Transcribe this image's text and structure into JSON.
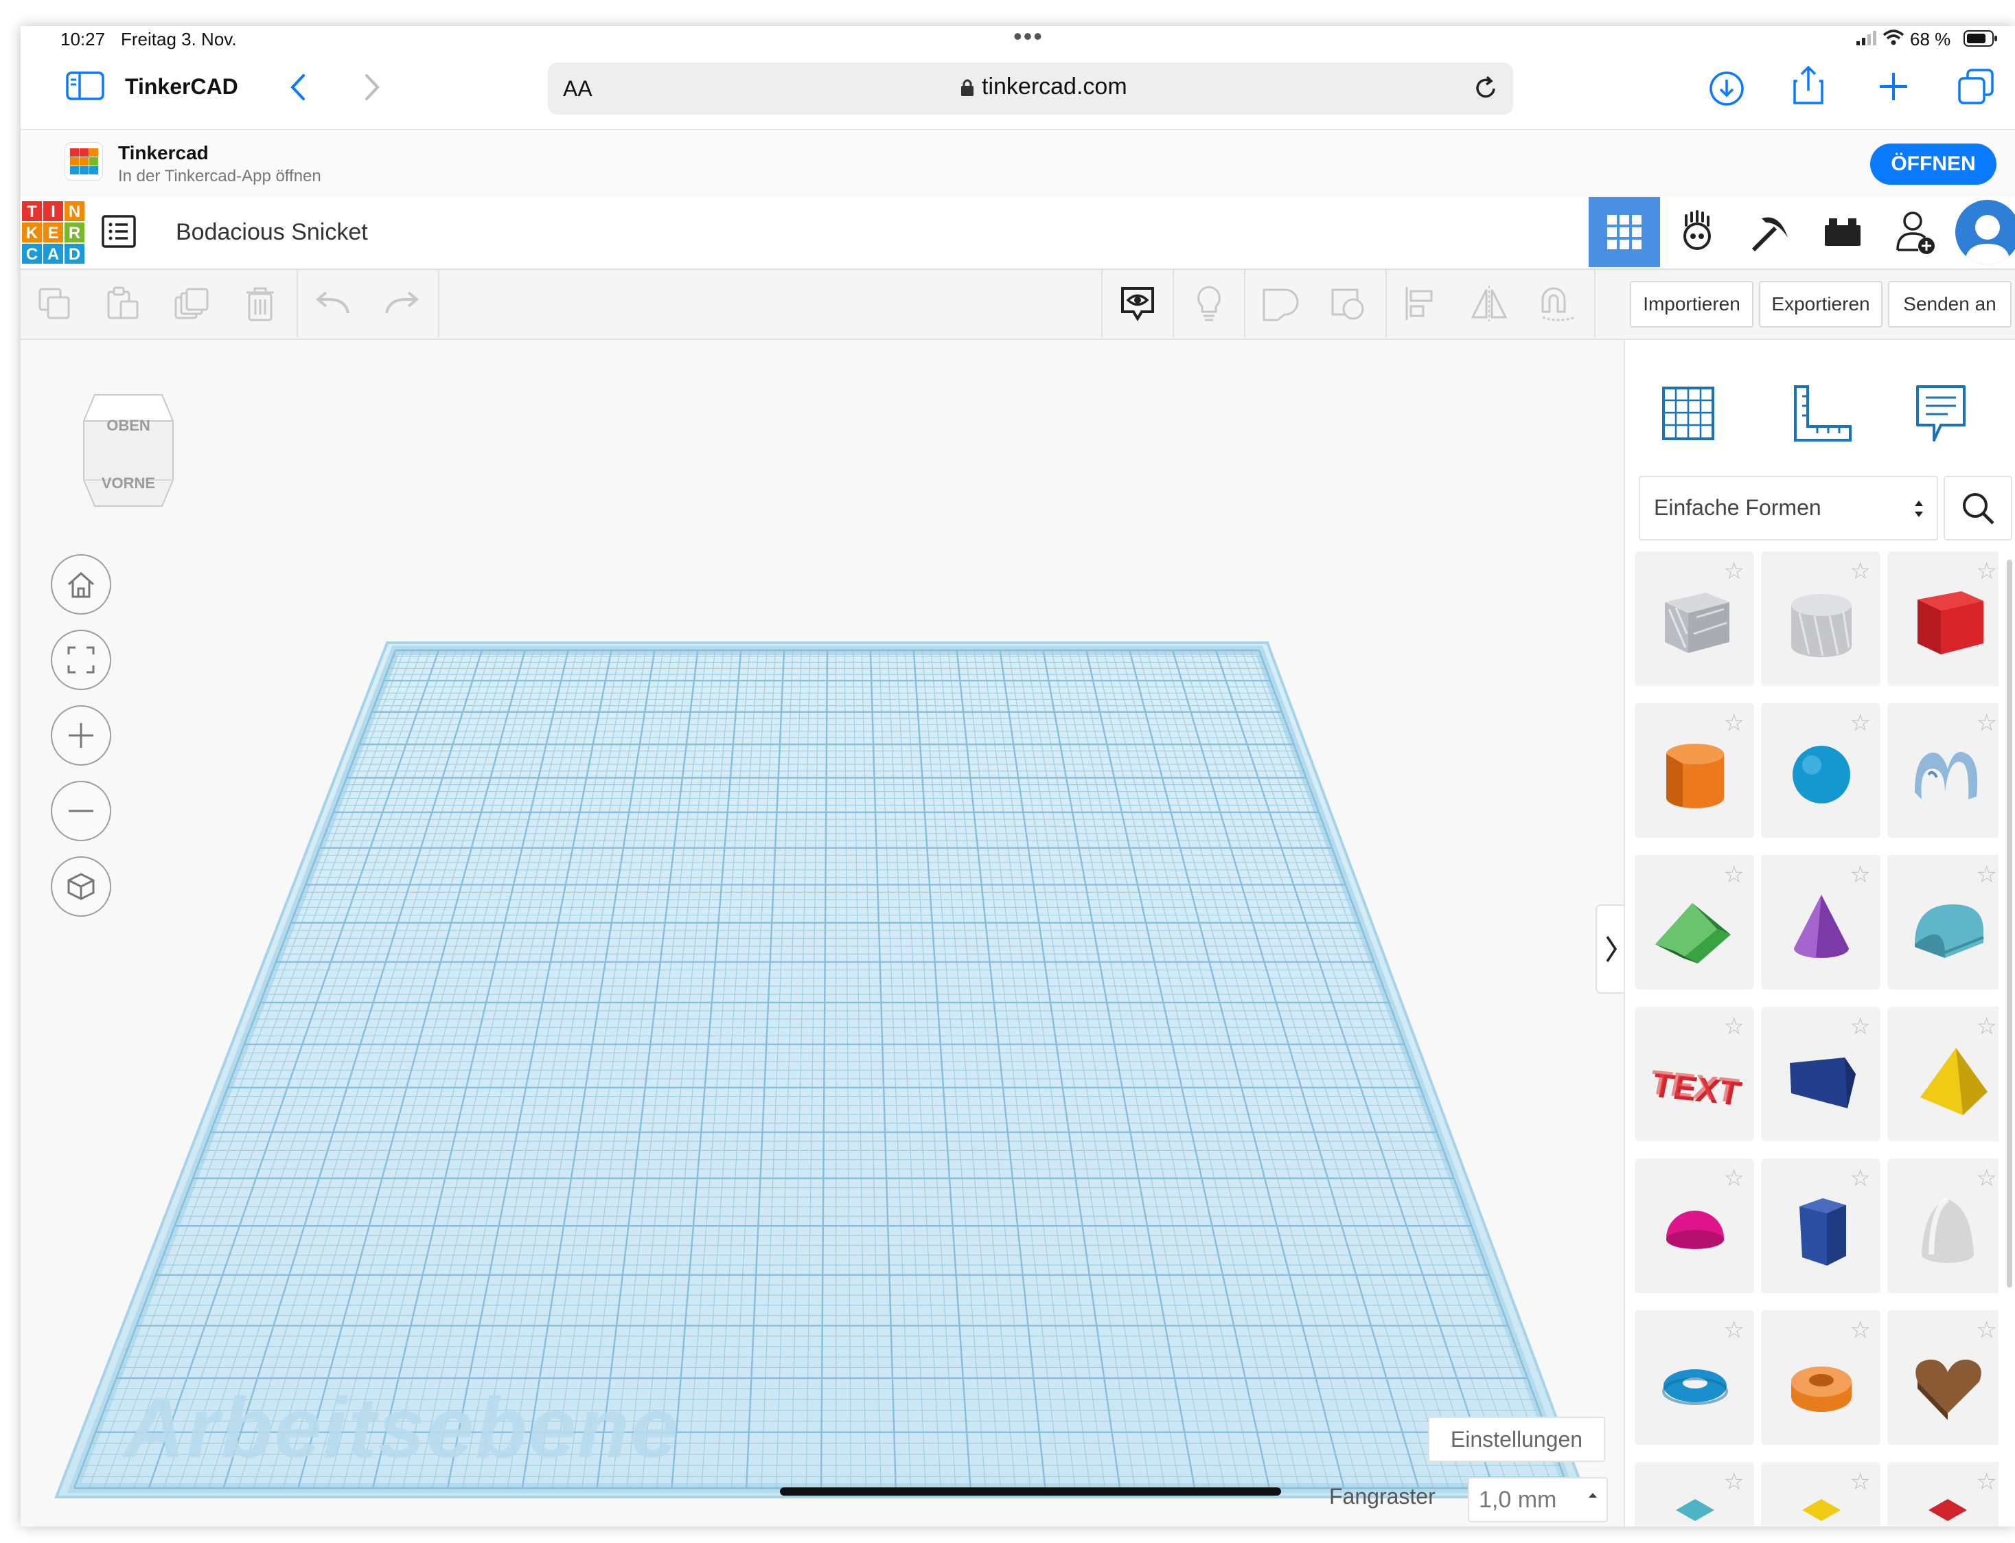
{
  "status_bar": {
    "time": "10:27",
    "date": "Freitag 3. Nov.",
    "battery": "68 %"
  },
  "browser": {
    "tab_title": "TinkerCAD",
    "text_size": "AA",
    "url": "tinkercad.com"
  },
  "app_banner": {
    "name": "Tinkercad",
    "subtitle": "In der Tinkercad-App öffnen",
    "open_button": "ÖFFNEN"
  },
  "logo": {
    "letters": [
      "T",
      "I",
      "N",
      "K",
      "E",
      "R",
      "C",
      "A",
      "D"
    ],
    "colors": [
      "#e5322d",
      "#e5322d",
      "#f18a00",
      "#f18a00",
      "#f18a00",
      "#7bb72b",
      "#1a9ad6",
      "#1a9ad6",
      "#1a9ad6"
    ]
  },
  "header": {
    "design_name": "Bodacious Snicket"
  },
  "toolbar": {
    "import": "Importieren",
    "export": "Exportieren",
    "send": "Senden an"
  },
  "view_cube": {
    "top": "OBEN",
    "front": "VORNE"
  },
  "workplane": {
    "label": "Arbeitsebene",
    "settings": "Einstellungen",
    "snap_label": "Fangraster",
    "snap_value": "1,0 mm"
  },
  "shapes_panel": {
    "category": "Einfache Formen",
    "shapes": [
      {
        "name": "box-hole",
        "color": "#b9bcc2"
      },
      {
        "name": "cylinder-hole",
        "color": "#c4c6cb"
      },
      {
        "name": "box",
        "color": "#d9252a"
      },
      {
        "name": "cylinder",
        "color": "#ec7a1d"
      },
      {
        "name": "sphere",
        "color": "#1598cf"
      },
      {
        "name": "scribble",
        "color": "#8fb8da"
      },
      {
        "name": "roof",
        "color": "#3aa341"
      },
      {
        "name": "cone",
        "color": "#7b3aa8"
      },
      {
        "name": "round-roof",
        "color": "#5fb6c8"
      },
      {
        "name": "text",
        "color": "#d0232b"
      },
      {
        "name": "wedge",
        "color": "#233e8b"
      },
      {
        "name": "pyramid",
        "color": "#f0cb15"
      },
      {
        "name": "half-sphere",
        "color": "#e0158c"
      },
      {
        "name": "polygon",
        "color": "#2c4fa3"
      },
      {
        "name": "paraboloid",
        "color": "#d6d6d6"
      },
      {
        "name": "torus",
        "color": "#1a8fce"
      },
      {
        "name": "tube",
        "color": "#e77c1d"
      },
      {
        "name": "heart",
        "color": "#8a5a35"
      }
    ]
  }
}
